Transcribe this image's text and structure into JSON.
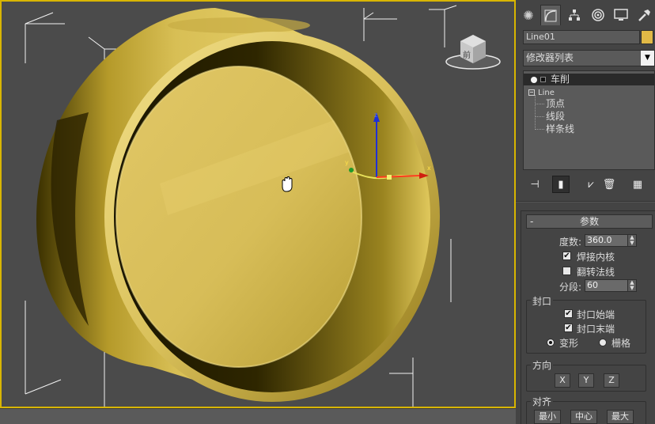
{
  "viewport": {
    "label": "3D viewport - lathe cylinder",
    "gizmo": {
      "x": "x",
      "y": "y",
      "z": "z"
    },
    "cursor_icon": "hand-pan-icon",
    "viewcube_face": "前"
  },
  "colors": {
    "viewport_border": "#d8b500",
    "object": "#d9c05a",
    "object_swatch": "#e1b946",
    "panel_bg": "#444444"
  },
  "tabs": [
    {
      "name": "create",
      "icon": "gear-sun-icon"
    },
    {
      "name": "modify",
      "icon": "modify-curve-icon"
    },
    {
      "name": "hierarchy",
      "icon": "hierarchy-icon"
    },
    {
      "name": "motion",
      "icon": "motion-icon"
    },
    {
      "name": "display",
      "icon": "display-monitor-icon"
    },
    {
      "name": "utilities",
      "icon": "hammer-icon"
    }
  ],
  "object_name": "Line01",
  "modifier_list": {
    "label": "修改器列表"
  },
  "stack": {
    "items": [
      {
        "label": "车削",
        "selected": true
      },
      {
        "label": "Line"
      },
      {
        "label": "顶点"
      },
      {
        "label": "线段"
      },
      {
        "label": "样条线"
      }
    ]
  },
  "params": {
    "title": "参数",
    "collapse": "-",
    "degrees_label": "度数:",
    "degrees_value": "360.0",
    "weld_core_label": "焊接内核",
    "weld_core_checked": true,
    "flip_normals_label": "翻转法线",
    "flip_normals_checked": false,
    "segments_label": "分段:",
    "segments_value": "60",
    "capping": {
      "title": "封口",
      "cap_start_label": "封口始端",
      "cap_start_checked": true,
      "cap_end_label": "封口末端",
      "cap_end_checked": true,
      "morph_label": "变形",
      "grid_label": "栅格",
      "selected": "morph"
    },
    "direction": {
      "title": "方向",
      "x": "X",
      "y": "Y",
      "z": "Z"
    },
    "align": {
      "title": "对齐",
      "min": "最小",
      "center": "中心",
      "max": "最大"
    }
  }
}
